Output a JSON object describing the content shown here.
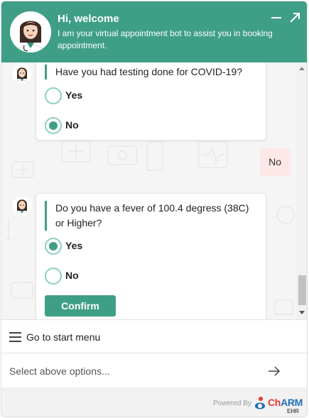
{
  "header": {
    "title": "Hi, welcome",
    "subtitle": "I am your virtual appointment bot to assist you in booking appointment.",
    "minimize_icon": "minimize-icon",
    "expand_icon": "expand-icon",
    "bg_color": "#3f9f86"
  },
  "chat": {
    "messages": [
      {
        "sender": "bot",
        "question": "Have you had testing done for COVID-19?",
        "options": [
          {
            "label": "Yes",
            "selected": false
          },
          {
            "label": "No",
            "selected": true
          }
        ]
      },
      {
        "sender": "user",
        "text": "No"
      },
      {
        "sender": "bot",
        "question": "Do you have a fever of 100.4 degress (38C) or Higher?",
        "options": [
          {
            "label": "Yes",
            "selected": true
          },
          {
            "label": "No",
            "selected": false
          }
        ],
        "button": "Confirm"
      }
    ]
  },
  "menu": {
    "label": "Go to start menu",
    "icon": "hamburger-icon"
  },
  "input": {
    "placeholder": "Select above options...",
    "send_icon": "arrow-right-icon"
  },
  "footer": {
    "powered_by": "Powered By",
    "brand_ch": "Ch",
    "brand_arm": "ARM",
    "brand_sub": "EHR"
  },
  "colors": {
    "accent": "#3f9f86",
    "user_bubble": "#fde7e7",
    "brand_red": "#e53935",
    "brand_blue": "#1e6fb8"
  }
}
